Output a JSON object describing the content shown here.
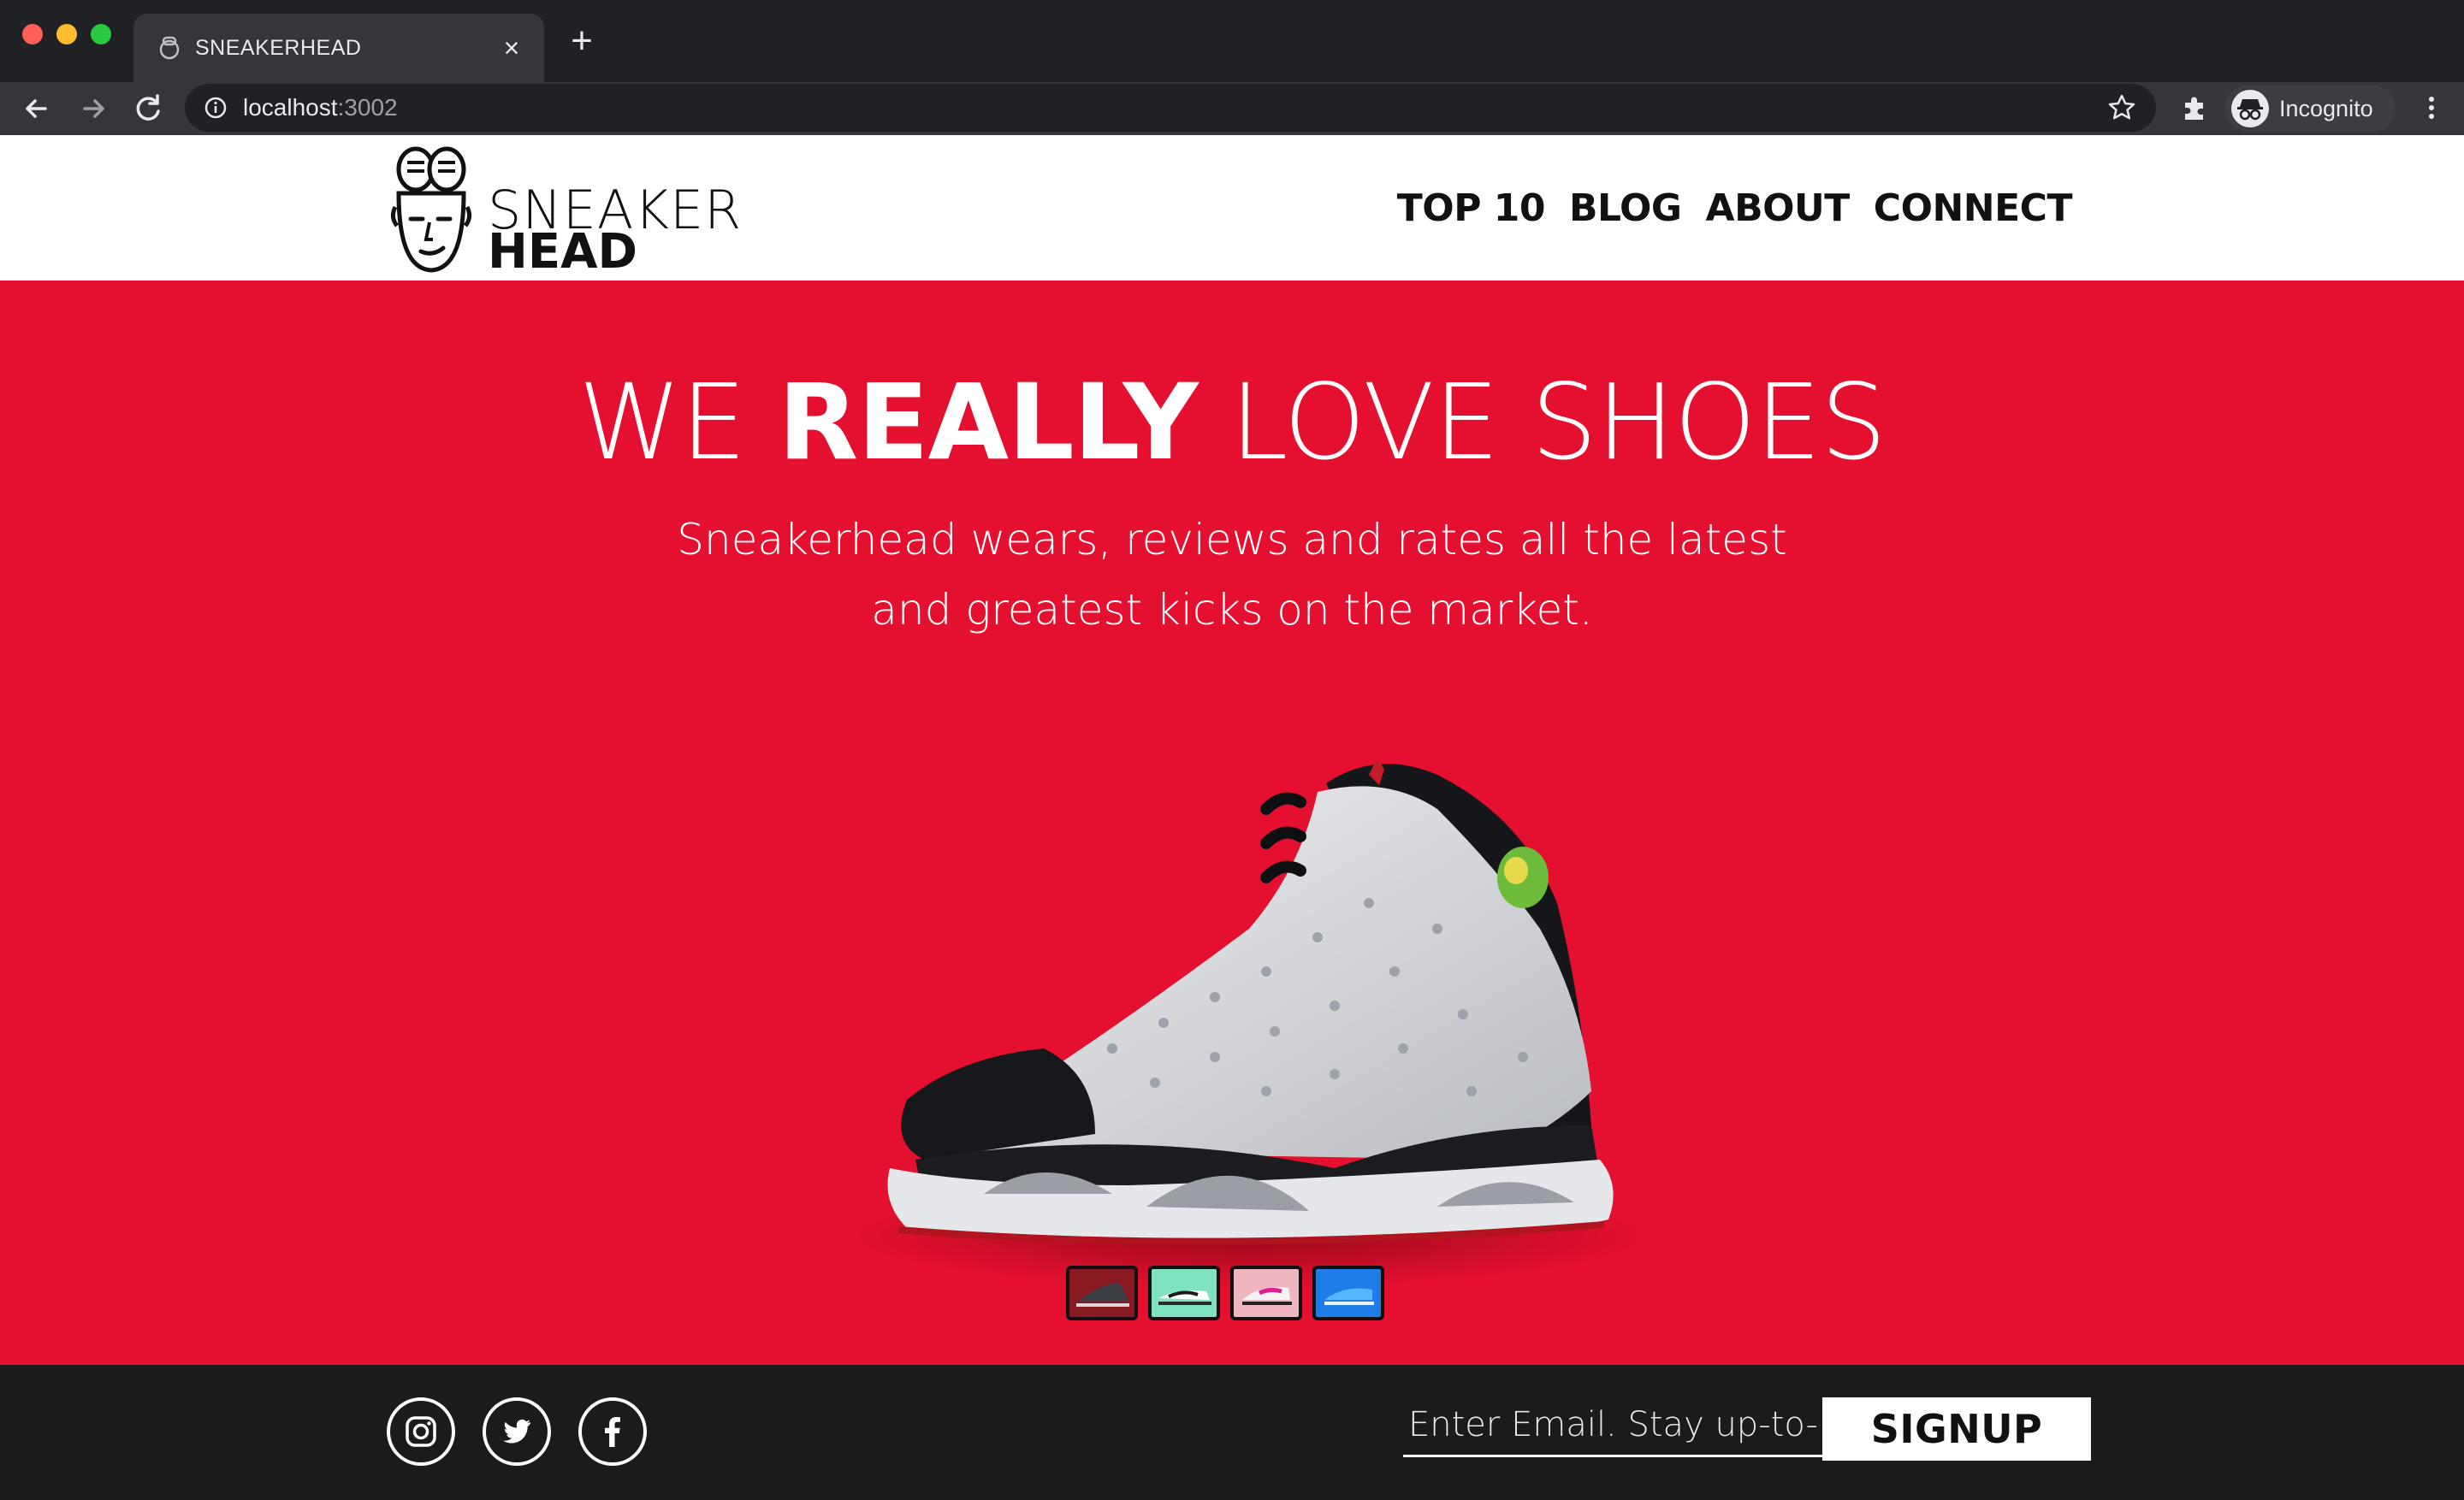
{
  "browser": {
    "tab_title": "SNEAKERHEAD",
    "tab_close": "×",
    "new_tab": "+",
    "url_host": "localhost",
    "url_port": ":3002",
    "profile_label": "Incognito"
  },
  "site": {
    "logo_line1": "SNEAKER",
    "logo_line2": "HEAD",
    "nav": [
      "TOP 10",
      "BLOG",
      "ABOUT",
      "CONNECT"
    ]
  },
  "hero": {
    "title_part1": "WE",
    "title_bold": "REALLY",
    "title_part2": "LOVE SHOES",
    "subtitle_line1": "Sneakerhead wears, reviews and rates all the latest",
    "subtitle_line2": "and greatest kicks on the market."
  },
  "footer": {
    "email_placeholder": "Enter Email. Stay up-to-date.",
    "signup_label": "SIGNUP",
    "social": [
      "instagram-icon",
      "twitter-icon",
      "facebook-icon"
    ]
  },
  "colors": {
    "hero_red": "#e5102f",
    "footer_dark": "#1b1b1c",
    "chrome_dark": "#202124"
  }
}
